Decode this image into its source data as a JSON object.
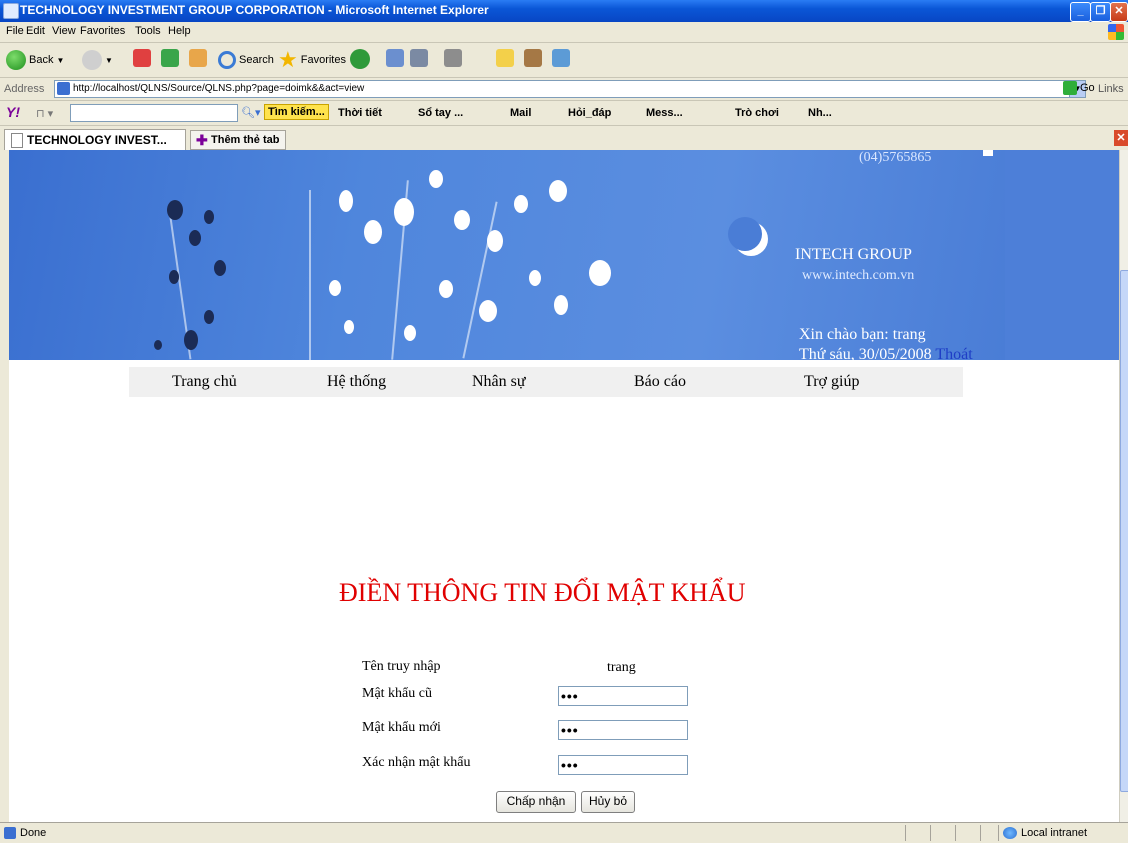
{
  "window": {
    "title": "TECHNOLOGY INVESTMENT GROUP CORPORATION - Microsoft Internet Explorer"
  },
  "menu": [
    "File",
    "Edit",
    "View",
    "Favorites",
    "Tools",
    "Help"
  ],
  "toolbar": {
    "back": "Back",
    "search": "Search",
    "favorites": "Favorites"
  },
  "address": {
    "label": "Address",
    "url": "http://localhost/QLNS/Source/QLNS.php?page=doimk&&act=view",
    "go": "Go",
    "links": "Links"
  },
  "yahoo": {
    "search_button": "Tìm kiếm...",
    "items": [
      "Thời tiết",
      "Sổ tay ...",
      "Mail",
      "Hỏi_đáp",
      "Mess...",
      "Trò chơi",
      "Nh..."
    ]
  },
  "tabs": {
    "active": "TECHNOLOGY INVEST...",
    "new_tab": "Thêm thẻ tab"
  },
  "banner": {
    "phone": "(04)5765865",
    "company": "INTECH GROUP",
    "website": "www.intech.com.vn",
    "welcome": "Xin chào bạn: trang",
    "date": "Thứ sáu, 30/05/2008",
    "logout": "Thoát"
  },
  "nav": [
    "Trang chủ",
    "Hệ thống",
    "Nhân sự",
    "Báo cáo",
    "Trợ giúp"
  ],
  "form": {
    "title": "ĐIỀN THÔNG TIN ĐỔI MẬT KHẨU",
    "username_label": "Tên truy nhập",
    "username_value": "trang",
    "old_password_label": "Mật khẩu cũ",
    "old_password_value": "•••",
    "new_password_label": "Mật khẩu mới",
    "new_password_value": "•••",
    "confirm_label": "Xác nhận mật khẩu",
    "confirm_value": "•••",
    "submit": "Chấp nhận",
    "cancel": "Hủy bỏ"
  },
  "status": {
    "text": "Done",
    "zone": "Local intranet"
  }
}
